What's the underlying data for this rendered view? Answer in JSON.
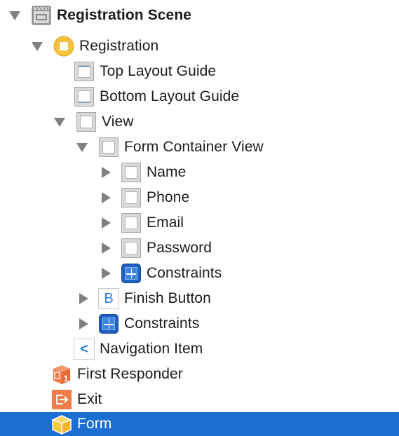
{
  "outline": {
    "items": [
      {
        "label": "Registration Scene",
        "icon": "scene-clapper-icon",
        "indent": 0,
        "disclosure": "expanded",
        "bold": true
      },
      {
        "label": "Registration",
        "icon": "view-controller-icon",
        "indent": 1,
        "disclosure": "expanded"
      },
      {
        "label": "Top Layout Guide",
        "icon": "top-layout-guide-icon",
        "indent": 2,
        "disclosure": "none"
      },
      {
        "label": "Bottom Layout Guide",
        "icon": "bottom-layout-guide-icon",
        "indent": 2,
        "disclosure": "none"
      },
      {
        "label": "View",
        "icon": "view-icon",
        "indent": 2,
        "disclosure": "expanded"
      },
      {
        "label": "Form Container View",
        "icon": "view-icon",
        "indent": 3,
        "disclosure": "expanded"
      },
      {
        "label": "Name",
        "icon": "view-icon",
        "indent": 4,
        "disclosure": "collapsed"
      },
      {
        "label": "Phone",
        "icon": "view-icon",
        "indent": 4,
        "disclosure": "collapsed"
      },
      {
        "label": "Email",
        "icon": "view-icon",
        "indent": 4,
        "disclosure": "collapsed"
      },
      {
        "label": "Password",
        "icon": "view-icon",
        "indent": 4,
        "disclosure": "collapsed"
      },
      {
        "label": "Constraints",
        "icon": "constraints-icon",
        "indent": 4,
        "disclosure": "collapsed"
      },
      {
        "label": "Finish Button",
        "icon": "button-icon",
        "indent": 3,
        "disclosure": "collapsed",
        "icon_text": "B"
      },
      {
        "label": "Constraints",
        "icon": "constraints-icon",
        "indent": 3,
        "disclosure": "collapsed"
      },
      {
        "label": "Navigation Item",
        "icon": "navigation-item-icon",
        "indent": 2,
        "disclosure": "none",
        "icon_text": "<"
      },
      {
        "label": "First Responder",
        "icon": "first-responder-icon",
        "indent": 1,
        "disclosure": "none"
      },
      {
        "label": "Exit",
        "icon": "exit-icon",
        "indent": 1,
        "disclosure": "none"
      },
      {
        "label": "Form",
        "icon": "form-object-cube-icon",
        "indent": 1,
        "disclosure": "none",
        "selected": true
      }
    ]
  },
  "colors": {
    "selection": "#1b6fd2",
    "view_controller": "#f7c33c",
    "first_responder": "#f07c4a",
    "exit": "#f07c4a",
    "object_cube": "#f9c93e",
    "constraints": "#1f5fbf",
    "accent_blue": "#2d7ee0"
  }
}
